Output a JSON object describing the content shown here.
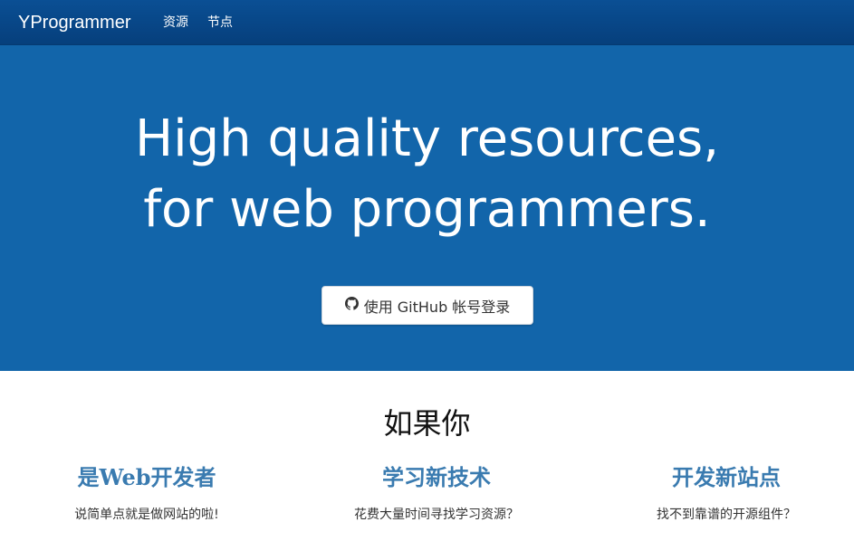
{
  "navbar": {
    "brand": "YProgrammer",
    "links": [
      {
        "label": "资源"
      },
      {
        "label": "节点"
      }
    ]
  },
  "hero": {
    "title_line1": "High quality resources,",
    "title_line2": "for web programmers.",
    "login_button": {
      "icon": "github-icon",
      "label": "使用 GitHub 帐号登录"
    },
    "background_color": "#1265aa"
  },
  "section": {
    "title": "如果你",
    "features": [
      {
        "title": "是Web开发者",
        "desc": "说简单点就是做网站的啦!"
      },
      {
        "title": "学习新技术",
        "desc": "花费大量时间寻找学习资源？"
      },
      {
        "title": "开发新站点",
        "desc": "找不到靠谱的开源组件？"
      }
    ],
    "accent_color": "#3a7bb0"
  }
}
